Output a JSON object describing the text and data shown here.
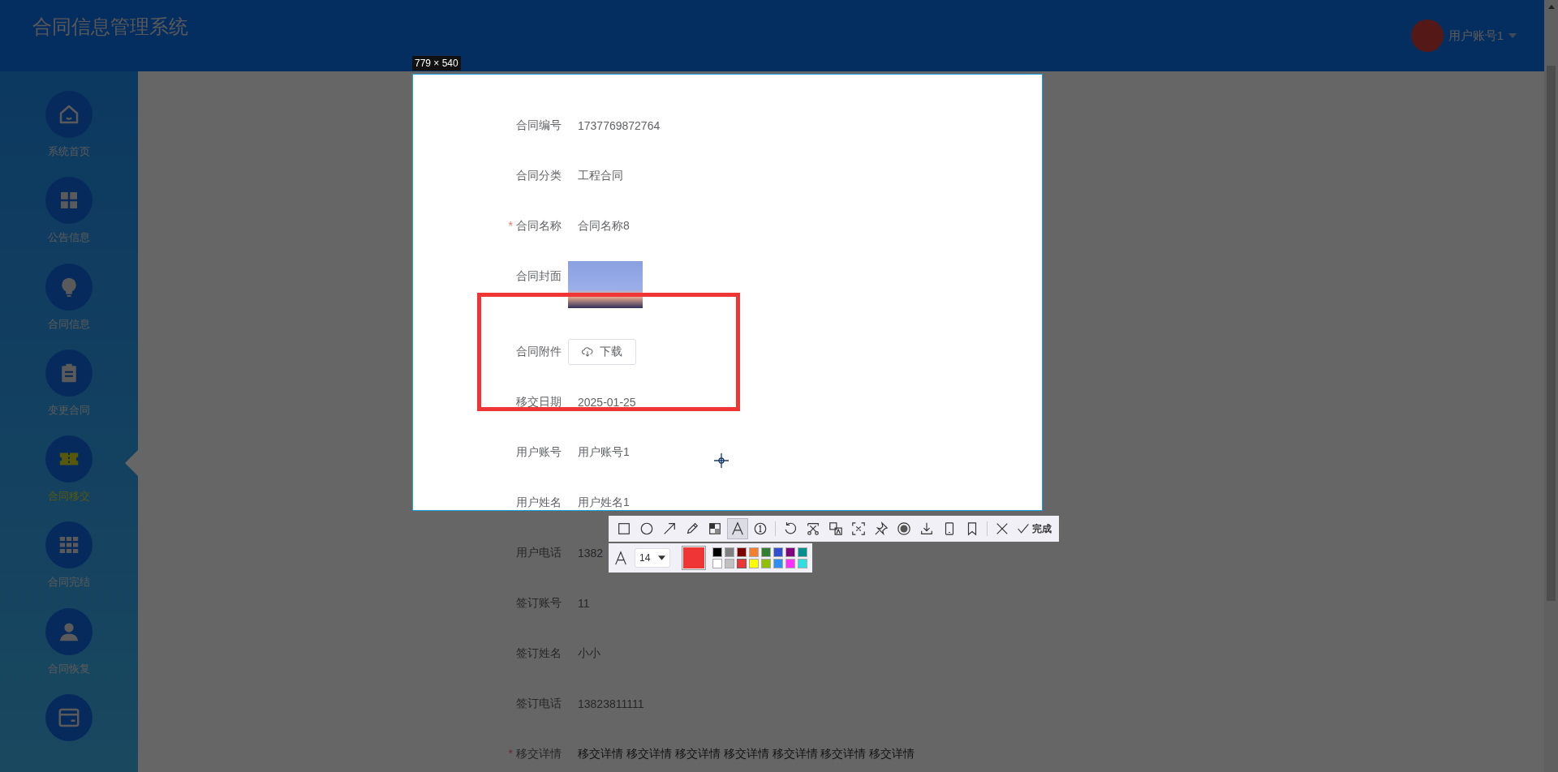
{
  "header": {
    "title": "合同信息管理系统",
    "user": "用户账号1"
  },
  "sidebar": {
    "items": [
      {
        "kind": "home",
        "label": "系统首页",
        "selected": false
      },
      {
        "kind": "grid",
        "label": "公告信息",
        "selected": false
      },
      {
        "kind": "bulb",
        "label": "合同信息",
        "selected": false
      },
      {
        "kind": "clipboard",
        "label": "变更合同",
        "selected": false
      },
      {
        "kind": "ticket",
        "label": "合同移交",
        "selected": true
      },
      {
        "kind": "apps",
        "label": "合同完结",
        "selected": false
      },
      {
        "kind": "user",
        "label": "合同恢复",
        "selected": false
      },
      {
        "kind": "card",
        "selected": false
      }
    ]
  },
  "form": {
    "fields": [
      {
        "kind": "text",
        "label": "合同编号",
        "value": "1737769872764"
      },
      {
        "kind": "text",
        "label": "合同分类",
        "value": "工程合同"
      },
      {
        "kind": "text",
        "label": "合同名称",
        "required_mark": "*",
        "value": "合同名称8"
      },
      {
        "kind": "image",
        "label": "合同封面"
      },
      {
        "kind": "download",
        "label": "合同附件",
        "button": "下载"
      },
      {
        "kind": "text",
        "label": "移交日期",
        "value": "2025-01-25"
      },
      {
        "kind": "text",
        "label": "用户账号",
        "value": "用户账号1"
      },
      {
        "kind": "text",
        "label": "用户姓名",
        "value": "用户姓名1"
      },
      {
        "kind": "text",
        "label": "用户电话",
        "value": "1382"
      },
      {
        "kind": "text",
        "label": "签订账号",
        "value": "11"
      },
      {
        "kind": "text",
        "label": "签订姓名",
        "value": "小小"
      },
      {
        "kind": "text",
        "label": "签订电话",
        "value": "13823811111"
      },
      {
        "kind": "text",
        "label": "移交详情",
        "required_mark": "*",
        "value": "移交详情 移交详情 移交详情 移交详情 移交详情 移交详情 移交详情"
      }
    ]
  },
  "capture": {
    "size_label": "779 × 540"
  },
  "toolbar": {
    "tools": [
      {
        "kind": "rectangle",
        "selected": false
      },
      {
        "kind": "ellipse",
        "selected": false
      },
      {
        "kind": "arrow",
        "selected": false
      },
      {
        "kind": "pencil",
        "selected": false
      },
      {
        "kind": "mosaic",
        "selected": false
      },
      {
        "kind": "text",
        "selected": true
      },
      {
        "kind": "number",
        "selected": false
      },
      {
        "kind": "separator"
      },
      {
        "kind": "undo",
        "selected": false
      },
      {
        "kind": "scissors",
        "selected": false
      },
      {
        "kind": "translate",
        "selected": false
      },
      {
        "kind": "ocr",
        "selected": false
      },
      {
        "kind": "pin",
        "selected": false
      },
      {
        "kind": "record",
        "selected": false
      },
      {
        "kind": "download",
        "selected": false
      },
      {
        "kind": "phone",
        "selected": false
      },
      {
        "kind": "bookmark",
        "selected": false
      },
      {
        "kind": "separator"
      },
      {
        "kind": "close",
        "selected": false
      }
    ],
    "done": "完成"
  },
  "text_options": {
    "font_size": "14",
    "palette": [
      {
        "color": "#000000",
        "selected": false
      },
      {
        "color": "#808080",
        "selected": false
      },
      {
        "color": "#800000",
        "selected": false
      },
      {
        "color": "#f08030",
        "selected": false
      },
      {
        "color": "#308030",
        "selected": false
      },
      {
        "color": "#3050d0",
        "selected": false
      },
      {
        "color": "#800080",
        "selected": false
      },
      {
        "color": "#009090",
        "selected": false
      },
      {
        "color": "#ffffff",
        "selected": false
      },
      {
        "color": "#c0c0c0",
        "selected": false
      },
      {
        "color": "#f03535",
        "selected": true
      },
      {
        "color": "#ffff00",
        "selected": false
      },
      {
        "color": "#90c000",
        "selected": false
      },
      {
        "color": "#3090f0",
        "selected": false
      },
      {
        "color": "#ff30ff",
        "selected": false
      },
      {
        "color": "#30e0e0",
        "selected": false
      }
    ]
  }
}
